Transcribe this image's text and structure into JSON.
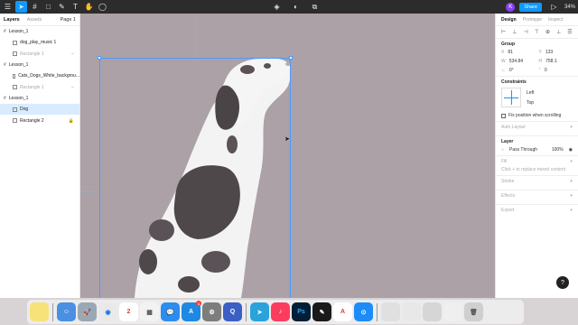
{
  "toolbar": {
    "zoom": "34%",
    "share_label": "Share",
    "avatar_initial": "K"
  },
  "left_panel": {
    "tabs": [
      "Layers",
      "Assets"
    ],
    "page_selector": "Page 1",
    "layers": [
      {
        "label": "Lesson_1",
        "kind": "frame"
      },
      {
        "label": "dog_play_music 1",
        "kind": "image"
      },
      {
        "label": "Rectangle 1",
        "kind": "rect"
      },
      {
        "label": "Lesson_1",
        "kind": "frame"
      },
      {
        "label": "Cats_Dogs_White_backgrou...",
        "kind": "image"
      },
      {
        "label": "Rectangle 1",
        "kind": "rect"
      },
      {
        "label": "Lesson_1",
        "kind": "frame"
      },
      {
        "label": "Dog",
        "kind": "image"
      },
      {
        "label": "Rectangle 2",
        "kind": "rect"
      }
    ]
  },
  "right_panel": {
    "tabs": [
      "Design",
      "Prototype",
      "Inspect"
    ],
    "group_title": "Group",
    "x_label": "X",
    "x_value": "81",
    "y_label": "Y",
    "y_value": "133",
    "w_label": "W",
    "w_value": "534.84",
    "h_label": "H",
    "h_value": "758.1",
    "rotation_value": "0°",
    "radius_value": "0",
    "constraints_title": "Constraints",
    "constraint_h": "Left",
    "constraint_v": "Top",
    "fix_position_label": "Fix position when scrolling",
    "auto_layout_title": "Auto Layout",
    "layer_title": "Layer",
    "blend_mode": "Pass Through",
    "opacity": "100%",
    "fill_title": "Fill",
    "fill_hint": "Click + to replace mixed content",
    "stroke_title": "Stroke",
    "effects_title": "Effects",
    "export_title": "Export"
  },
  "dock": {
    "calendar_day": "2"
  },
  "colors": {
    "canvas": "#aba1a6",
    "accent": "#0d99ff",
    "selection": "#4c9bff"
  }
}
